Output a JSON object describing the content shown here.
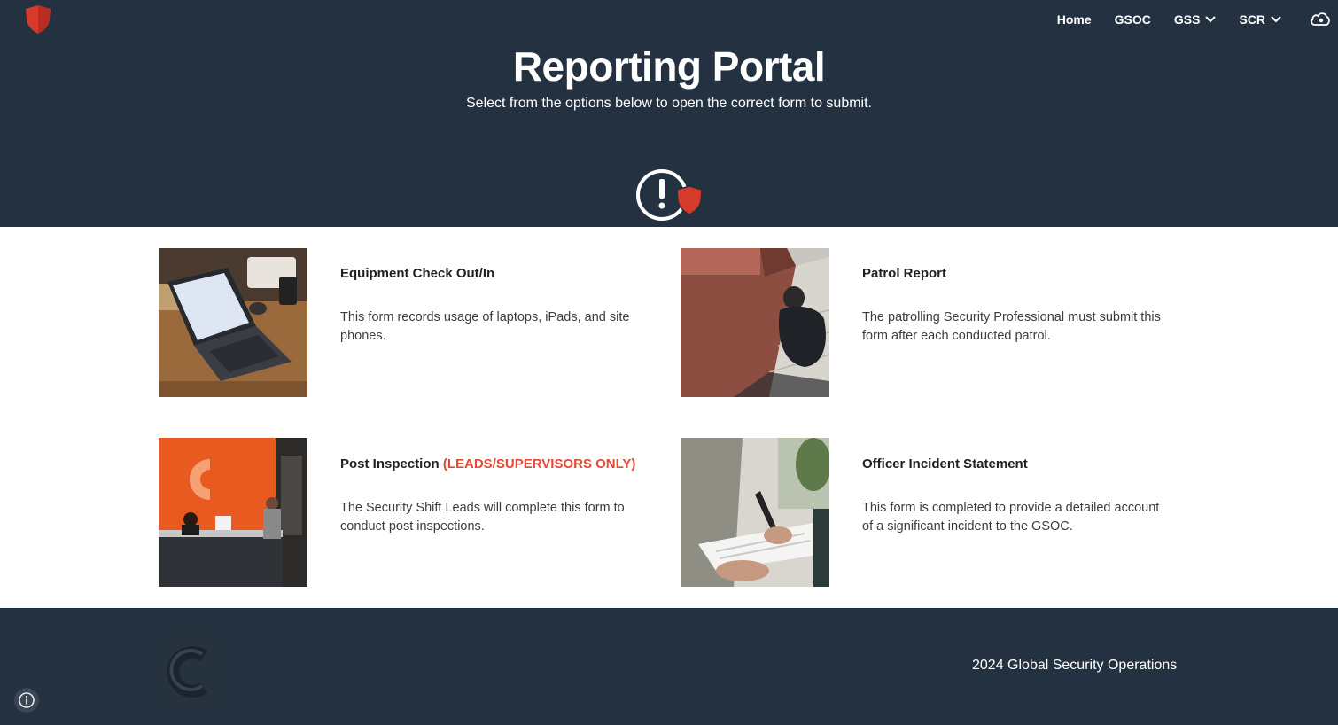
{
  "nav": {
    "items": [
      {
        "label": "Home",
        "has_dropdown": false
      },
      {
        "label": "GSOC",
        "has_dropdown": false
      },
      {
        "label": "GSS",
        "has_dropdown": true
      },
      {
        "label": "SCR",
        "has_dropdown": true
      }
    ]
  },
  "hero": {
    "title": "Reporting Portal",
    "subtitle": "Select from the options below to open the correct form to submit."
  },
  "cards": [
    {
      "title": "Equipment Check Out/In",
      "badge": "",
      "description": "This form records usage of laptops, iPads, and site phones."
    },
    {
      "title": "Patrol Report",
      "badge": "",
      "description": "The patrolling Security Professional must submit this form after each conducted patrol."
    },
    {
      "title": "Post Inspection",
      "badge": "(LEADS/SUPERVISORS ONLY)",
      "description": "The Security Shift Leads will complete this form to conduct post inspections."
    },
    {
      "title": "Officer Incident Statement",
      "badge": "",
      "description": "This form is completed to provide a detailed account of a significant incident to the GSOC."
    }
  ],
  "footer": {
    "text": "2024 Global Security Operations"
  },
  "colors": {
    "header_bg": "#243140",
    "accent_red": "#e24a35",
    "shield_red": "#d63a2b"
  },
  "icons": {
    "logo": "shield-icon",
    "alert": "alert-shield-icon",
    "account": "cloud-account-icon",
    "info": "info-icon"
  }
}
